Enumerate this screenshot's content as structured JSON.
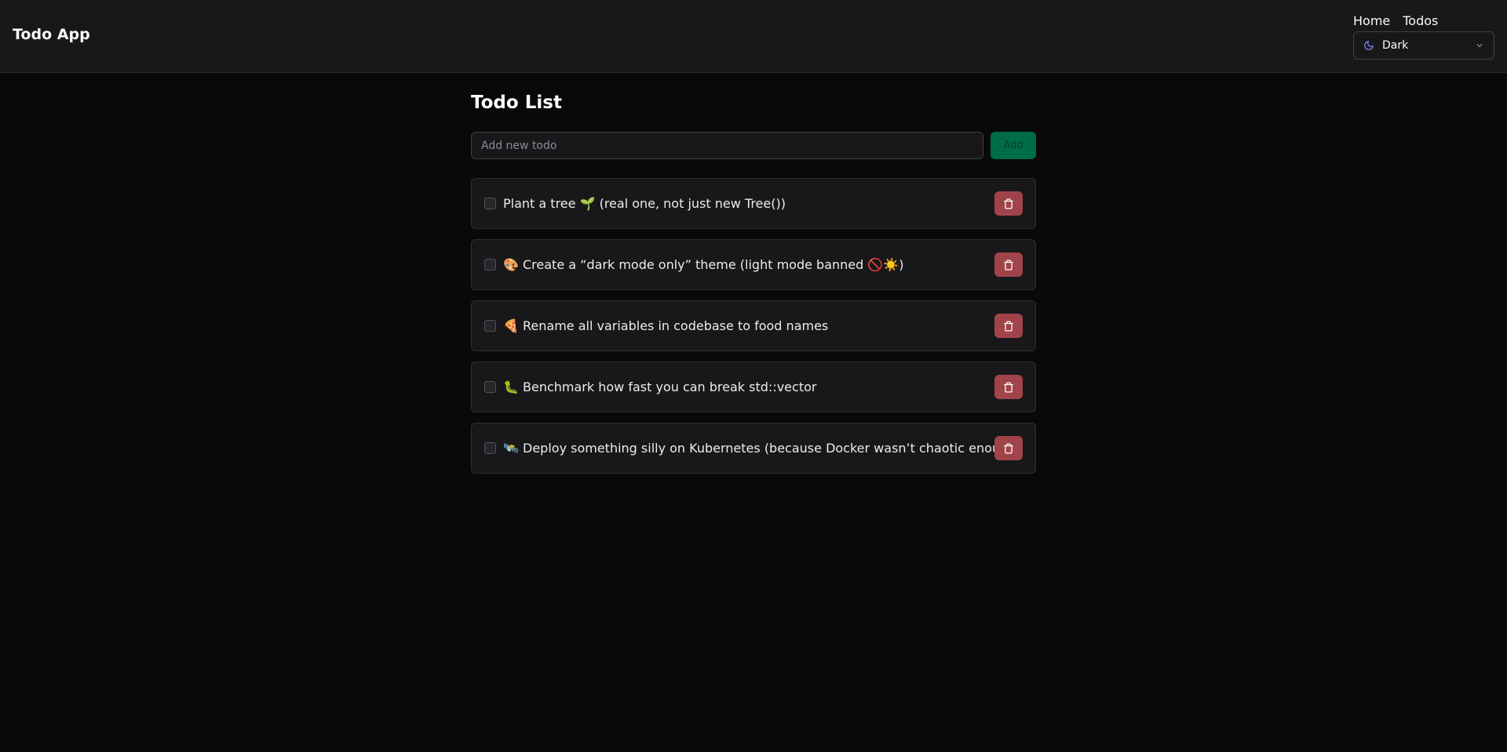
{
  "header": {
    "app_title": "Todo App",
    "nav": [
      {
        "label": "Home"
      },
      {
        "label": "Todos"
      }
    ],
    "theme_select": {
      "value": "Dark",
      "icon": "moon-icon"
    }
  },
  "main": {
    "title": "Todo List",
    "input": {
      "value": "",
      "placeholder": "Add new todo"
    },
    "add_label": "Add",
    "todos": [
      {
        "text": "Plant a tree 🌱 (real one, not just new Tree())",
        "done": false
      },
      {
        "text": "🎨 Create a “dark mode only” theme (light mode banned 🚫☀️)",
        "done": false
      },
      {
        "text": "🍕 Rename all variables in codebase to food names",
        "done": false
      },
      {
        "text": "🐛 Benchmark how fast you can break std::vector",
        "done": false
      },
      {
        "text": "🛰️ Deploy something silly on Kubernetes (because Docker wasn’t chaotic enough)",
        "done": false
      }
    ]
  },
  "colors": {
    "background": "#09090b",
    "header_bg": "#18181b",
    "add_button": "#006d4a",
    "delete_button": "#a1444a",
    "accent_moon": "#8b8cf8"
  }
}
